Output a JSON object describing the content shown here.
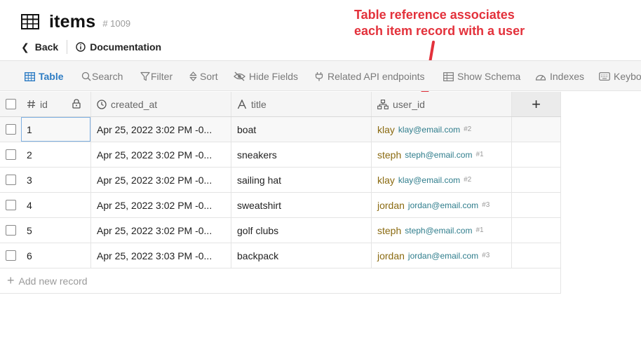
{
  "header": {
    "title": "items",
    "table_id": "# 1009",
    "back_label": "Back",
    "doc_label": "Documentation"
  },
  "annotation": {
    "line1": "Table reference associates",
    "line2": "each item record with a user",
    "color": "#e3313b"
  },
  "toolbar": {
    "items": [
      {
        "label": "Table",
        "icon": "table-icon",
        "active": true
      },
      {
        "label": "Search",
        "icon": "search-icon"
      },
      {
        "label": "Filter",
        "icon": "filter-icon"
      },
      {
        "label": "Sort",
        "icon": "sort-icon"
      },
      {
        "label": "Hide Fields",
        "icon": "eye-slash-icon"
      },
      {
        "label": "Related API endpoints",
        "icon": "plug-icon"
      },
      {
        "label": "Show Schema",
        "icon": "schema-icon"
      },
      {
        "label": "Indexes",
        "icon": "gauge-icon"
      },
      {
        "label": "Keybo",
        "icon": "keyboard-icon"
      }
    ]
  },
  "columns": [
    {
      "label": "id",
      "icon": "hash-icon"
    },
    {
      "label": "created_at",
      "icon": "clock-icon"
    },
    {
      "label": "title",
      "icon": "text-icon"
    },
    {
      "label": "user_id",
      "icon": "relation-icon"
    }
  ],
  "add_column_label": "+",
  "rows": [
    {
      "id": "1",
      "created_at": "Apr 25, 2022 3:02 PM -0...",
      "title": "boat",
      "user": {
        "name": "klay",
        "email": "klay@email.com",
        "ref": "#2"
      }
    },
    {
      "id": "2",
      "created_at": "Apr 25, 2022 3:02 PM -0...",
      "title": "sneakers",
      "user": {
        "name": "steph",
        "email": "steph@email.com",
        "ref": "#1"
      }
    },
    {
      "id": "3",
      "created_at": "Apr 25, 2022 3:02 PM -0...",
      "title": "sailing hat",
      "user": {
        "name": "klay",
        "email": "klay@email.com",
        "ref": "#2"
      }
    },
    {
      "id": "4",
      "created_at": "Apr 25, 2022 3:02 PM -0...",
      "title": "sweatshirt",
      "user": {
        "name": "jordan",
        "email": "jordan@email.com",
        "ref": "#3"
      }
    },
    {
      "id": "5",
      "created_at": "Apr 25, 2022 3:02 PM -0...",
      "title": "golf clubs",
      "user": {
        "name": "steph",
        "email": "steph@email.com",
        "ref": "#1"
      }
    },
    {
      "id": "6",
      "created_at": "Apr 25, 2022 3:03 PM -0...",
      "title": "backpack",
      "user": {
        "name": "jordan",
        "email": "jordan@email.com",
        "ref": "#3"
      }
    }
  ],
  "add_record_label": "Add new record"
}
